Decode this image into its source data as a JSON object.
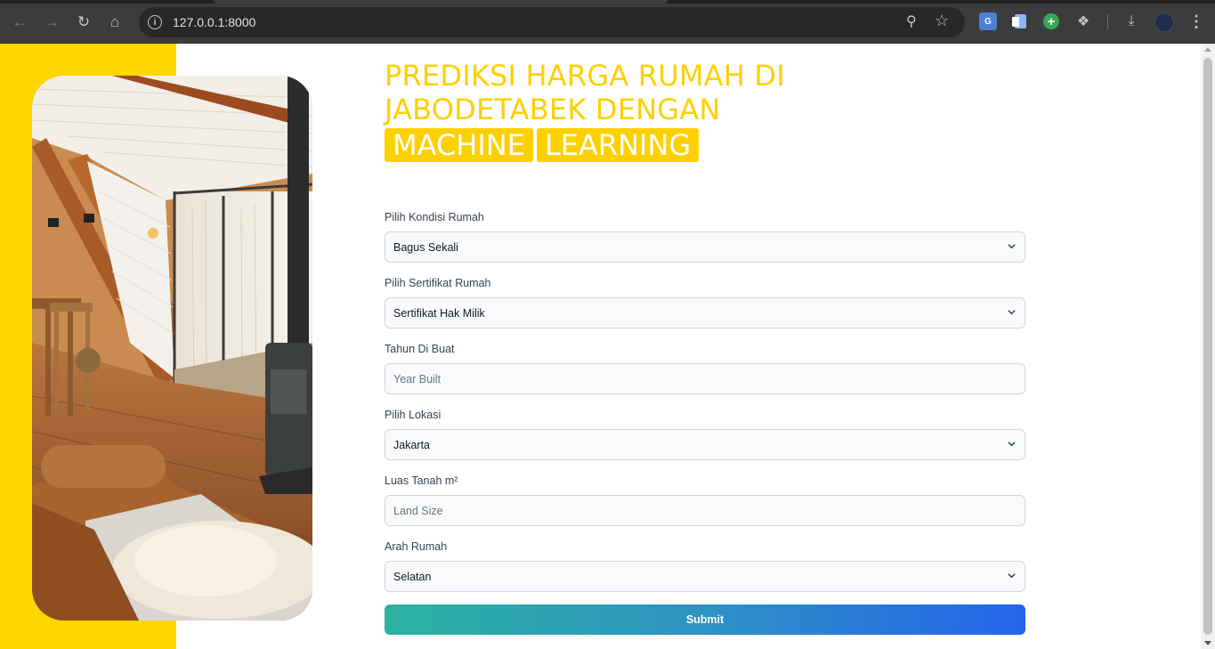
{
  "browser": {
    "url": "127.0.0.1:8000",
    "icons": [
      "back-icon",
      "forward-icon",
      "reload-icon",
      "home-icon",
      "site-info-icon",
      "zoom-icon",
      "bookmark-star-icon",
      "translate-icon",
      "docs-extension-icon",
      "add-extension-icon",
      "extensions-puzzle-icon",
      "download-icon",
      "profile-avatar",
      "menu-kebab-icon"
    ]
  },
  "hero": {
    "title_lines": [
      "PREDIKSI HARGA RUMAH DI",
      "JABODETABEK DENGAN"
    ],
    "highlight_words": [
      "MACHINE",
      "LEARNING"
    ],
    "accent_color": "#ffd600"
  },
  "form": {
    "kondisi": {
      "label": "Pilih Kondisi Rumah",
      "value": "Bagus Sekali"
    },
    "sertifikat": {
      "label": "Pilih Sertifikat Rumah",
      "value": "Sertifikat Hak Milik"
    },
    "tahun": {
      "label": "Tahun Di Buat",
      "placeholder": "Year Built"
    },
    "lokasi": {
      "label": "Pilih Lokasi",
      "value": "Jakarta"
    },
    "luas": {
      "label": "Luas Tanah m²",
      "placeholder": "Land Size"
    },
    "arah": {
      "label": "Arah Rumah",
      "value": "Selatan"
    },
    "submit_label": "Submit",
    "submit_gradient": [
      "#2bb3a0",
      "#2563eb"
    ]
  }
}
